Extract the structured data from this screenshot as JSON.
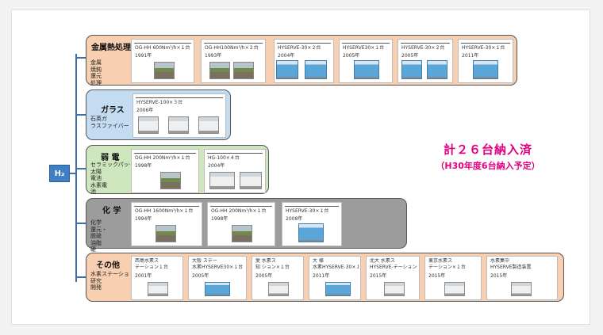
{
  "hub": {
    "label": "H₂"
  },
  "groups": {
    "metal": {
      "title": "金属熱処理",
      "desc": "金属\n焼鈍\n還元\n処理",
      "cards": [
        {
          "label": "OG-HH 600Nm³/h×１台",
          "year": "1991年"
        },
        {
          "label": "OG-HH100Nm³/h×２台",
          "year": "1993年"
        },
        {
          "label": "HYSERVE-30×２台",
          "year": "2004年"
        },
        {
          "label": "HYSERVE30×１台",
          "year": "2005年"
        },
        {
          "label": "HYSERVE-30×２台",
          "year": "2005年"
        },
        {
          "label": "HYSERVE-30×１台",
          "year": "2011年"
        }
      ]
    },
    "glass": {
      "title": "ガラス",
      "desc": "石英ガ\nラスファイバー",
      "cards": [
        {
          "label": "HYSERVE-100×３台",
          "year": "2006年"
        }
      ]
    },
    "weak": {
      "title": "弱 電",
      "desc": "セラミックパッケージ\n太陽\n電池\n水素電\n池",
      "cards": [
        {
          "label": "OG-HH 200Nm³/h×１台",
          "year": "1998年"
        },
        {
          "label": "HG-100×４台",
          "year": "2004年"
        }
      ]
    },
    "chem": {
      "title": "化 学",
      "desc": "化学\n還元・\n脱硫\n油脂\n硬",
      "cards": [
        {
          "label": "OG-HH 1600Nm³/h×１台",
          "year": "1994年"
        },
        {
          "label": "OG-HH 200Nm³/h×１台",
          "year": "1998年"
        },
        {
          "label": "HYSERVE-30×１台",
          "year": "2008年"
        }
      ]
    },
    "other": {
      "title": "その他",
      "desc": "水素ステーション\n研究\n開発",
      "cards": [
        {
          "label": "西島水素ス\nテーション１台",
          "year": "2001年"
        },
        {
          "label": "大阪 ステー\n水素HYSERVE30×１台",
          "year": "2005年"
        },
        {
          "label": "愛 水素ス\n知 ション×１台",
          "year": "2005年"
        },
        {
          "label": "大 様\n水素HYSERVE-30×１台",
          "year": "2011年"
        },
        {
          "label": "北大 水素ス\nHYSERVE-テーション",
          "year": "2015年"
        },
        {
          "label": "東京水素ス\nテーション×１台",
          "year": "2015年"
        },
        {
          "label": "水素集中\nHYSERVE製造装置",
          "year": "2015年"
        }
      ]
    }
  },
  "announcement": {
    "line1": "計２６台納入済",
    "line2": "（H30年度6台納入予定）"
  },
  "colors": {
    "accent_magenta": "#e3007f",
    "hub_blue": "#3f7fc2",
    "metal_bg": "#f8cfb0",
    "glass_bg": "#c4dcf2",
    "weak_bg": "#cde6bd",
    "chem_bg": "#9c9c9c"
  }
}
